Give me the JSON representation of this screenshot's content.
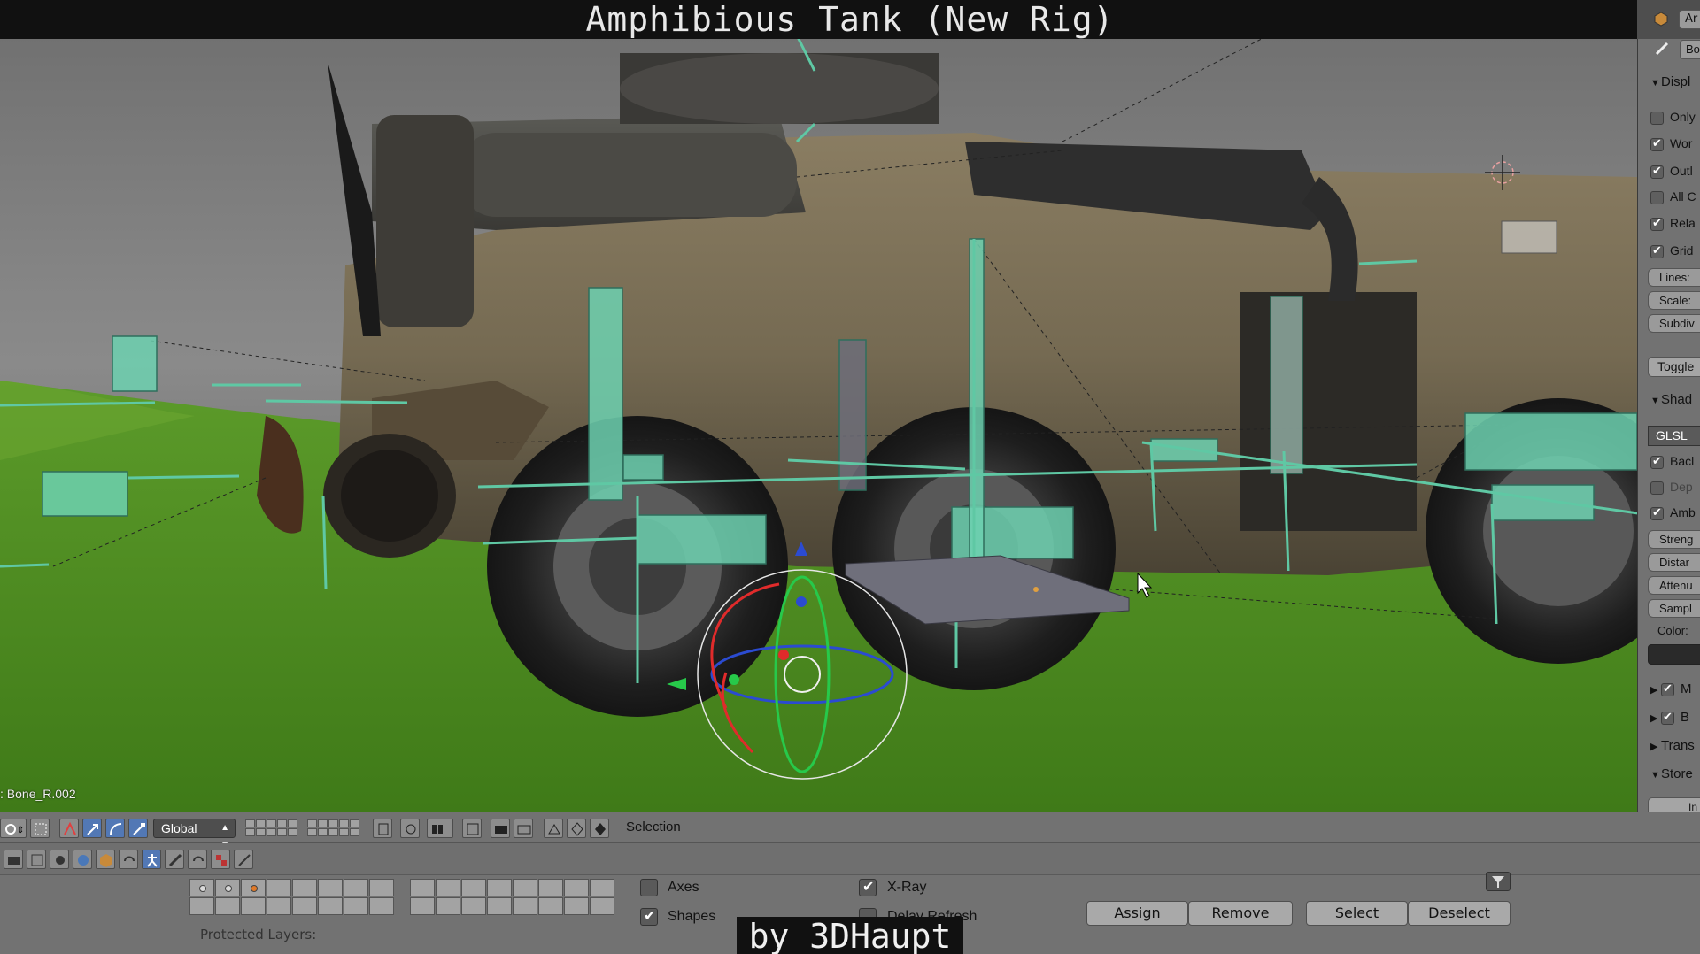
{
  "overlay": {
    "title": "Amphibious Tank (New Rig)",
    "credit": "by 3DHaupt"
  },
  "viewport": {
    "active_bone_label": ": Bone_R.002",
    "ground_color": "#4d8a1f",
    "bone_color": "#6dd1b0",
    "background_color": "#808080"
  },
  "header": {
    "orientation": "Global",
    "mode_label": "Selection",
    "active_accent": "#5278b5"
  },
  "bone_group": {
    "axes_label": "Axes",
    "axes_checked": false,
    "shapes_label": "Shapes",
    "shapes_checked": true,
    "xray_label": "X-Ray",
    "xray_checked": true,
    "delay_refresh_label": "Delay Refresh",
    "delay_refresh_checked": false,
    "assign_label": "Assign",
    "remove_label": "Remove",
    "select_label": "Select",
    "deselect_label": "Deselect",
    "protected_layers_label": "Protected Layers:"
  },
  "properties_panel": {
    "tab_1": "Ar",
    "tab_2": "Bo",
    "display_header": "Displ",
    "opt_only": "Only",
    "opt_world": "Wor",
    "opt_outline": "Outl",
    "opt_all": "All C",
    "opt_relation": "Rela",
    "opt_grid": "Grid",
    "field_lines": "Lines:",
    "field_scale": "Scale:",
    "field_subdiv": "Subdiv",
    "toggle_label": "Toggle",
    "shading_header": "Shad",
    "shading_mode": "GLSL",
    "opt_backface": "Bacl",
    "opt_depth": "Dep",
    "opt_ambient": "Amb",
    "field_strength": "Streng",
    "field_distance": "Distar",
    "field_attenuation": "Attenu",
    "field_samples": "Sampl",
    "color_label": "Color:",
    "sub_m": "M",
    "sub_b": "B",
    "transform_header": "Trans",
    "stored_header": "Store",
    "stored_btn": "In"
  }
}
